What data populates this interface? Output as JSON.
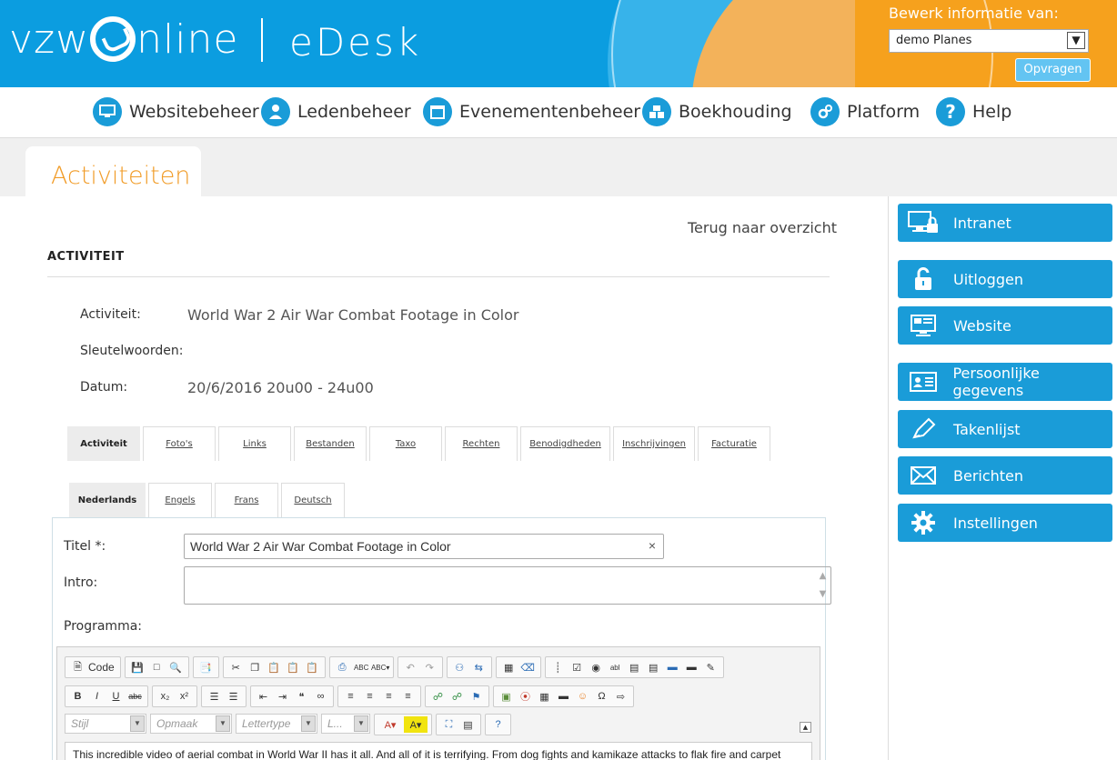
{
  "header": {
    "logo_left": "vzw",
    "logo_right": "nline",
    "product": "eDesk",
    "bewerk_label": "Bewerk informatie van:",
    "org_select_value": "demo Planes",
    "opvragen_label": "Opvragen"
  },
  "nav": {
    "items": [
      {
        "label": "Websitebeheer",
        "icon": "monitor-icon"
      },
      {
        "label": "Ledenbeheer",
        "icon": "user-icon"
      },
      {
        "label": "Evenementenbeheer",
        "icon": "calendar-icon"
      },
      {
        "label": "Boekhouding",
        "icon": "boxes-icon"
      },
      {
        "label": "Platform",
        "icon": "gears-icon"
      },
      {
        "label": "Help",
        "icon": "question-icon"
      }
    ]
  },
  "page": {
    "title": "Activiteiten",
    "back_link": "Terug naar overzicht",
    "section_heading": "ACTIVITEIT"
  },
  "details": {
    "activiteit_label": "Activiteit:",
    "activiteit_value": "World War 2 Air War Combat Footage in Color",
    "sleutelwoorden_label": "Sleutelwoorden:",
    "datum_label": "Datum:",
    "datum_value": "20/6/2016 20u00 - 24u00"
  },
  "tabs": [
    "Activiteit",
    "Foto's",
    "Links",
    "Bestanden",
    "Taxo",
    "Rechten",
    "Benodigdheden",
    "Inschrijvingen",
    "Facturatie"
  ],
  "lang_tabs": [
    "Nederlands",
    "Engels",
    "Frans",
    "Deutsch"
  ],
  "form": {
    "titel_label": "Titel *:",
    "titel_value": "World War 2 Air War Combat Footage in Color",
    "clear_glyph": "×",
    "intro_label": "Intro:",
    "programma_label": "Programma:"
  },
  "editor": {
    "code_label": "Code",
    "combos": [
      "Stijl",
      "Opmaak",
      "Lettertype",
      "L..."
    ],
    "content": "This incredible video of aerial combat in World War II has it all. And all of it is terrifying. From dog fights and kamikaze attacks to flak fire and carpet"
  },
  "sidebar": {
    "items": [
      {
        "label": "Intranet",
        "icon": "intranet-icon"
      },
      {
        "label": "Uitloggen",
        "icon": "unlock-icon"
      },
      {
        "label": "Website",
        "icon": "website-icon"
      },
      {
        "label": "Persoonlijke gegevens",
        "icon": "id-card-icon"
      },
      {
        "label": "Takenlijst",
        "icon": "pencil-icon"
      },
      {
        "label": "Berichten",
        "icon": "envelope-icon"
      },
      {
        "label": "Instellingen",
        "icon": "gear-icon"
      }
    ]
  },
  "colors": {
    "brand_blue": "#1a9cd8",
    "accent_orange": "#f19c28",
    "header_orange": "#f6a11d"
  }
}
